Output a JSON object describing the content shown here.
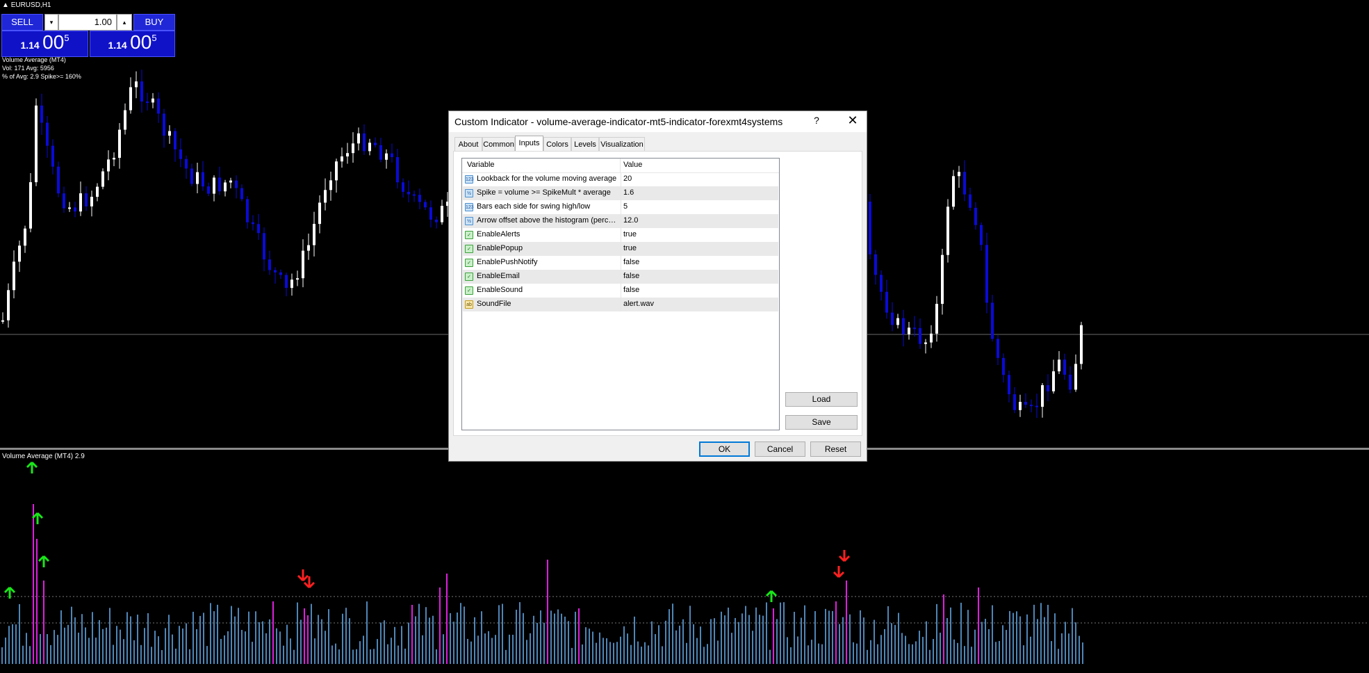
{
  "chart": {
    "symbol": "EURUSD,H1",
    "indicator_info": {
      "name": "Volume Average (MT4)",
      "line1": "Vol: 171  Avg: 5956",
      "line2": "% of Avg: 2.9  Spike>= 160%"
    },
    "subwindow_label": "Volume Average (MT4) 2.9",
    "colors": {
      "bull": "#ffffff",
      "bear": "#0a0ad8",
      "volume_normal": "#4f86b8",
      "volume_spike": "#e01ee0",
      "arrow_up": "#19e619",
      "arrow_down": "#ff2020",
      "separator": "#8a8a8a"
    }
  },
  "one_click": {
    "sell_label": "SELL",
    "buy_label": "BUY",
    "lot_value": "1.00",
    "sell_price_small": "1.14",
    "sell_price_big": "00",
    "sell_price_sup": "5",
    "buy_price_small": "1.14",
    "buy_price_big": "00",
    "buy_price_sup": "5"
  },
  "dialog": {
    "title": "Custom Indicator - volume-average-indicator-mt5-indicator-forexmt4systems",
    "help": "?",
    "close": "✕",
    "tabs": [
      "About",
      "Common",
      "Inputs",
      "Colors",
      "Levels",
      "Visualization"
    ],
    "active_tab": "Inputs",
    "columns": [
      "Variable",
      "Value"
    ],
    "rows": [
      {
        "icon": "123",
        "variable": "Lookback for the volume moving average",
        "value": "20"
      },
      {
        "icon": "½",
        "variable": "Spike = volume >= SpikeMult * average",
        "value": "1.6"
      },
      {
        "icon": "123",
        "variable": "Bars each side for swing high/low",
        "value": "5"
      },
      {
        "icon": "½",
        "variable": "Arrow offset above the histogram (percent of bar height)",
        "value": "12.0"
      },
      {
        "icon": "✓",
        "variable": "EnableAlerts",
        "value": "true"
      },
      {
        "icon": "✓",
        "variable": "EnablePopup",
        "value": "true"
      },
      {
        "icon": "✓",
        "variable": "EnablePushNotify",
        "value": "false"
      },
      {
        "icon": "✓",
        "variable": "EnableEmail",
        "value": "false"
      },
      {
        "icon": "✓",
        "variable": "EnableSound",
        "value": "false"
      },
      {
        "icon": "ab",
        "variable": "SoundFile",
        "value": "alert.wav"
      }
    ],
    "load_label": "Load",
    "save_label": "Save",
    "ok_label": "OK",
    "cancel_label": "Cancel",
    "reset_label": "Reset"
  }
}
